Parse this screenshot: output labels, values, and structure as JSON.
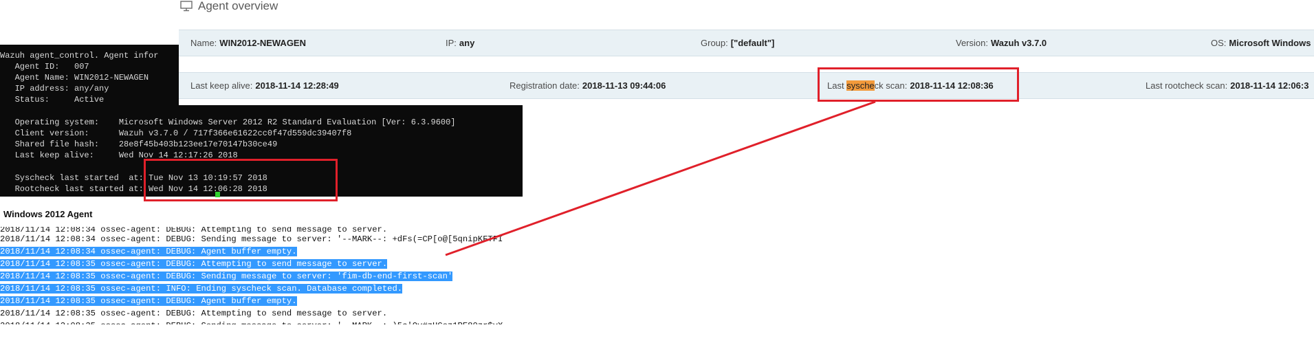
{
  "overview": {
    "title": "Agent overview",
    "icon": "monitor-icon"
  },
  "bar1": {
    "name_label": "Name:",
    "name_value": "WIN2012-NEWAGEN",
    "ip_label": "IP:",
    "ip_value": "any",
    "group_label": "Group:",
    "group_value": "[\"default\"]",
    "version_label": "Version:",
    "version_value": "Wazuh v3.7.0",
    "os_label": "OS:",
    "os_value": "Microsoft Windows"
  },
  "bar2": {
    "keepalive_label": "Last keep alive:",
    "keepalive_value": "2018-11-14 12:28:49",
    "registration_label": "Registration date:",
    "registration_value": "2018-11-13 09:44:06",
    "syscheck_label_pre": "Last ",
    "syscheck_label_hl": "sysche",
    "syscheck_label_post": "ck scan:",
    "syscheck_value": "2018-11-14 12:08:36",
    "rootcheck_label": "Last rootcheck scan:",
    "rootcheck_value": "2018-11-14 12:06:3"
  },
  "terminal": {
    "lines": [
      "Wazuh agent_control. Agent infor",
      "   Agent ID:   007",
      "   Agent Name: WIN2012-NEWAGEN",
      "   IP address: any/any",
      "   Status:     Active",
      "",
      "   Operating system:    Microsoft Windows Server 2012 R2 Standard Evaluation [Ver: 6.3.9600]",
      "   Client version:      Wazuh v3.7.0 / 717f366e61622cc0f47d559dc39407f8",
      "   Shared file hash:    28e8f45b403b123ee17e70147b30ce49",
      "   Last keep alive:     Wed Nov 14 12:17:26 2018",
      "",
      "   Syscheck last started  at: Tue Nov 13 10:19:57 2018",
      "   Rootcheck last started at: Wed Nov 14 12:06:28 2018"
    ]
  },
  "log": {
    "title": "Windows 2012 Agent",
    "lines": [
      {
        "text": "2018/11/14 12:08:34 ossec-agent: DEBUG: Attempting to send message to server.",
        "selected": false
      },
      {
        "text": "2018/11/14 12:08:34 ossec-agent: DEBUG: Sending message to server: '--MARK--: +dFs(=CP[o@[5qnipKFTFI",
        "selected": false
      },
      {
        "text": "2018/11/14 12:08:34 ossec-agent: DEBUG: Agent buffer empty.",
        "selected": true
      },
      {
        "text": "2018/11/14 12:08:35 ossec-agent: DEBUG: Attempting to send message to server.",
        "selected": true
      },
      {
        "text": "2018/11/14 12:08:35 ossec-agent: DEBUG: Sending message to server: 'fim-db-end-first-scan'",
        "selected": true
      },
      {
        "text": "2018/11/14 12:08:35 ossec-agent: INFO: Ending syscheck scan. Database completed.",
        "selected": true
      },
      {
        "text": "2018/11/14 12:08:35 ossec-agent: DEBUG: Agent buffer empty.",
        "selected": true
      },
      {
        "text": "2018/11/14 12:08:35 ossec-agent: DEBUG: Attempting to send message to server.",
        "selected": false
      },
      {
        "text": "2018/11/14 12:08:35 ossec-agent: DEBUG: Sending message to server: '--MARK--: )5c'Ov#zHCsz1RE80zr$vX",
        "selected": false
      }
    ]
  },
  "colors": {
    "annotation": "#e0202a",
    "highlight": "#f39a3b",
    "selection": "#3399ff",
    "bar_bg": "#e9f1f5",
    "terminal_bg": "#0b0b0b",
    "cursor": "#2fd12f"
  }
}
